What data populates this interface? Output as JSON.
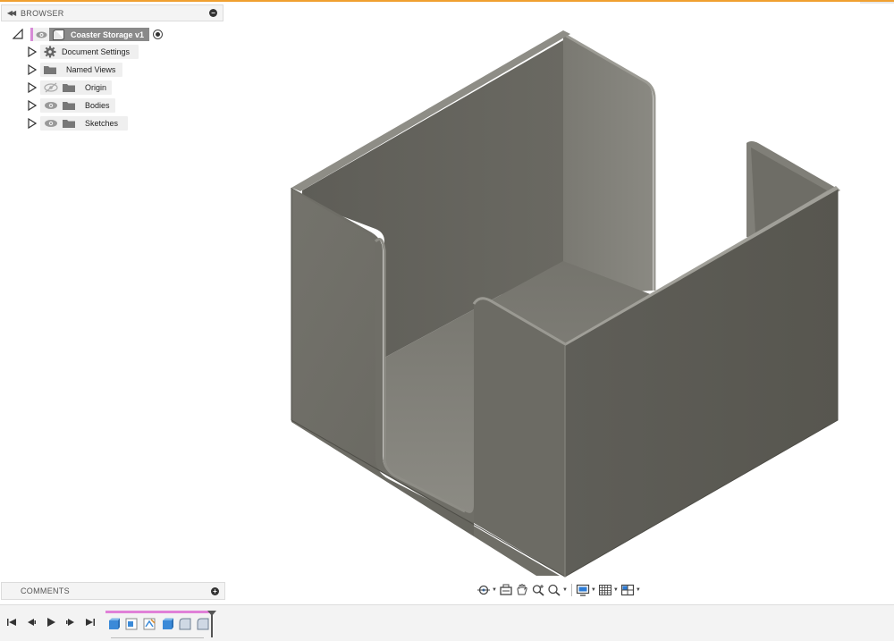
{
  "browser": {
    "title": "BROWSER",
    "root": {
      "label": "Coaster Storage v1"
    },
    "items": [
      {
        "label": "Document Settings",
        "icon": "gear-icon"
      },
      {
        "label": "Named Views",
        "icon": "folder-icon"
      },
      {
        "label": "Origin",
        "icon": "folder-icon",
        "visibility": "hidden"
      },
      {
        "label": "Bodies",
        "icon": "folder-icon",
        "visibility": "visible"
      },
      {
        "label": "Sketches",
        "icon": "folder-icon",
        "visibility": "visible"
      }
    ]
  },
  "comments": {
    "title": "COMMENTS"
  },
  "navigation_toolbar": {
    "tools": [
      "orbit-icon",
      "look-at-icon",
      "pan-icon",
      "zoom-icon",
      "zoom-window-icon",
      "display-settings-icon",
      "grid-icon",
      "viewports-icon"
    ]
  },
  "timeline": {
    "controls": [
      "go-to-start-icon",
      "step-back-icon",
      "play-icon",
      "step-forward-icon",
      "go-to-end-icon"
    ],
    "features": [
      "extrude-icon",
      "sketch-icon",
      "sketch-icon",
      "extrude-icon",
      "fillet-icon",
      "fillet-icon"
    ]
  },
  "colors": {
    "accent_top": "#f0a030",
    "timeline_range": "#e080d8",
    "model_gray": "#6b6a63"
  }
}
